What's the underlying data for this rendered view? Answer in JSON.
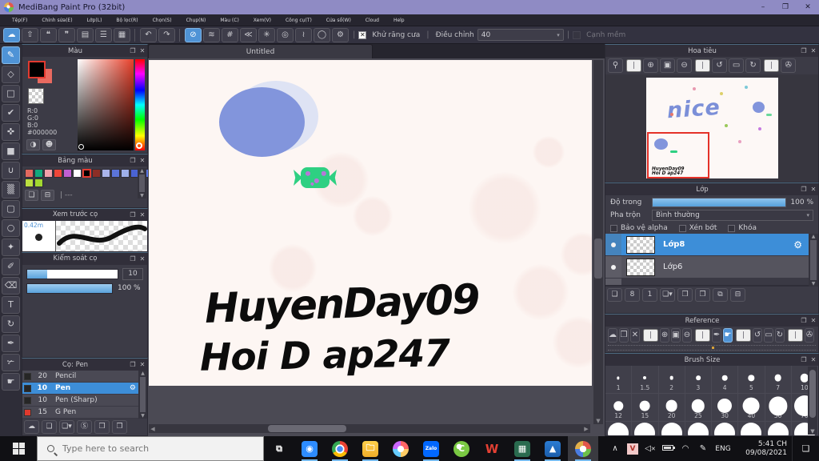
{
  "window": {
    "title": "MediBang Paint Pro (32bit)"
  },
  "icons": {
    "minimize": "–",
    "maximize": "❐",
    "close": "✕",
    "popout": "❐",
    "panel_close": "✕",
    "caret_down": "▾",
    "up_arrow": "▲",
    "down_arrow": "▼",
    "left_arrow": "◀",
    "right_arrow": "▶",
    "chevron_up": "∧",
    "gear": "⚙",
    "eye": "●"
  },
  "menu": {
    "items": [
      "Tệp(F)",
      "Chỉnh sửa(E)",
      "Lớp(L)",
      "Bộ lọc(R)",
      "Chọn(S)",
      "Chụp(N)",
      "Màu (C)",
      "Xem(V)",
      "Công cụ(T)",
      "Cửa sổ(W)",
      "Cloud",
      "Help"
    ]
  },
  "toolbar": {
    "buttons": [
      {
        "name": "cloud-save-button",
        "glyph": "☁",
        "active": true
      },
      {
        "name": "share-button",
        "glyph": "⇧"
      },
      {
        "name": "comment-filled-button",
        "glyph": "❝"
      },
      {
        "name": "comment-outline-button",
        "glyph": "❞"
      },
      {
        "name": "document-button",
        "glyph": "▤"
      },
      {
        "name": "list-button",
        "glyph": "☰"
      },
      {
        "name": "panel-layout-button",
        "glyph": "▦"
      },
      {
        "name": "toolbar-separator",
        "glyph": "",
        "sep": true
      },
      {
        "name": "undo-button",
        "glyph": "↶"
      },
      {
        "name": "redo-button",
        "glyph": "↷"
      },
      {
        "name": "toolbar-separator",
        "glyph": "",
        "sep": true
      },
      {
        "name": "snap-off-button",
        "glyph": "⊘",
        "active": true
      },
      {
        "name": "snap-parallel-button",
        "glyph": "≋"
      },
      {
        "name": "snap-grid-button",
        "glyph": "#"
      },
      {
        "name": "snap-vanishing-button",
        "glyph": "≪"
      },
      {
        "name": "snap-radial-button",
        "glyph": "✳"
      },
      {
        "name": "snap-concentric-button",
        "glyph": "◎"
      },
      {
        "name": "snap-curve-button",
        "glyph": "≀"
      },
      {
        "name": "snap-ellipse-button",
        "glyph": "◯"
      },
      {
        "name": "snap-settings-button",
        "glyph": "⚙"
      }
    ],
    "antialias_label": "Khử răng cưa",
    "antialias_checked": "✕",
    "correction_label": "Điều chỉnh",
    "correction_value": "40",
    "soft_edge_label": "Cạnh mềm"
  },
  "tools": [
    {
      "name": "brush-tool",
      "glyph": "✎",
      "active": true
    },
    {
      "name": "eraser-tool",
      "glyph": "◇"
    },
    {
      "name": "figure-tool",
      "glyph": "□"
    },
    {
      "name": "control-point-tool",
      "glyph": "✔"
    },
    {
      "name": "move-tool",
      "glyph": "✜"
    },
    {
      "name": "fill-rect-tool",
      "glyph": "■"
    },
    {
      "name": "bucket-tool",
      "glyph": "∪"
    },
    {
      "name": "gradient-tool",
      "glyph": "▒"
    },
    {
      "name": "select-marquee-tool",
      "glyph": "▢"
    },
    {
      "name": "lasso-tool",
      "glyph": "○"
    },
    {
      "name": "magic-wand-tool",
      "glyph": "✦"
    },
    {
      "name": "select-pen-tool",
      "glyph": "✐"
    },
    {
      "name": "select-eraser-tool",
      "glyph": "⌫"
    },
    {
      "name": "text-tool",
      "glyph": "T"
    },
    {
      "name": "rotate-view-tool",
      "glyph": "↻"
    },
    {
      "name": "eyedropper-tool",
      "glyph": "✒"
    },
    {
      "name": "divide-tool",
      "glyph": "✃"
    },
    {
      "name": "hand-tool",
      "glyph": "☛"
    }
  ],
  "color_panel": {
    "title": "Màu",
    "r": "R:0",
    "g": "G:0",
    "b": "B:0",
    "hex": "#000000",
    "buttons": [
      {
        "name": "palette-mode-button",
        "glyph": "◑"
      },
      {
        "name": "skin-color-button",
        "glyph": "☻"
      }
    ]
  },
  "palette_panel": {
    "title": "Bảng màu",
    "empty": "| ---",
    "swatches": [
      {
        "c": "#e2695f"
      },
      {
        "c": "#12a97e"
      },
      {
        "c": "#f2a0aa"
      },
      {
        "c": "#ef4639"
      },
      {
        "c": "#c05fd3"
      },
      {
        "c": "#ffffff"
      },
      {
        "c": "#000000",
        "selected": true
      },
      {
        "c": "#8c2e26"
      },
      {
        "c": "#a9b4ea"
      },
      {
        "c": "#5b74d8"
      },
      {
        "c": "#9fb0ea"
      },
      {
        "c": "#4a63d4"
      },
      {
        "c": "#5a78e8"
      },
      {
        "c": "#bbdf40"
      },
      {
        "c": "#a2d830"
      }
    ],
    "buttons": [
      {
        "name": "add-palette-color-button",
        "glyph": "❏"
      },
      {
        "name": "delete-palette-color-button",
        "glyph": "⊟"
      }
    ]
  },
  "preview_panel": {
    "title": "Xem trước cọ",
    "size": "0.42m"
  },
  "control_panel": {
    "title": "Kiểm soát cọ",
    "size_value": "10",
    "opacity_value": "100 %"
  },
  "brush_panel": {
    "title": "Cọ: Pen",
    "brushes": [
      {
        "size": "20",
        "name": "Pencil",
        "chip": "#262626"
      },
      {
        "size": "10",
        "name": "Pen",
        "chip": "#262626",
        "selected": true
      },
      {
        "size": "10",
        "name": "Pen (Sharp)",
        "chip": "#262626"
      },
      {
        "size": "15",
        "name": "G Pen",
        "chip": "#e03a2e"
      }
    ],
    "buttons": [
      {
        "name": "brush-cloud-button",
        "glyph": "☁"
      },
      {
        "name": "brush-add-button",
        "glyph": "❏"
      },
      {
        "name": "brush-add-menu-button",
        "glyph": "❏▾"
      },
      {
        "name": "brush-script-button",
        "glyph": "Ⓢ"
      },
      {
        "name": "brush-folder-button",
        "glyph": "❒"
      },
      {
        "name": "brush-duplicate-button",
        "glyph": "❐"
      }
    ]
  },
  "canvas": {
    "tab": "Untitled",
    "text_line1": "HuyenDay09",
    "text_line2": "Hoi D ap247"
  },
  "navigator": {
    "title": "Hoa tiêu",
    "thumb_word": "nice",
    "vp_line1": "HuyenDay09",
    "vp_line2": "Hoi D ap247",
    "buttons": [
      {
        "name": "nav-zoom-reset-button",
        "glyph": "⚲"
      },
      {
        "name": "nav-separator",
        "glyph": "",
        "sep": true
      },
      {
        "name": "nav-zoom-in-button",
        "glyph": "⊕"
      },
      {
        "name": "nav-fit-button",
        "glyph": "▣"
      },
      {
        "name": "nav-zoom-out-button",
        "glyph": "⊖"
      },
      {
        "name": "nav-separator",
        "glyph": "",
        "sep": true
      },
      {
        "name": "nav-rotate-left-button",
        "glyph": "↺"
      },
      {
        "name": "nav-rotate-reset-button",
        "glyph": "▭"
      },
      {
        "name": "nav-rotate-right-button",
        "glyph": "↻"
      },
      {
        "name": "nav-separator",
        "glyph": "",
        "sep": true
      },
      {
        "name": "nav-lock-button",
        "glyph": "✇"
      }
    ]
  },
  "layers_panel": {
    "title": "Lớp",
    "opacity_label": "Độ trong",
    "opacity_value": "100 %",
    "blend_label": "Pha trộn",
    "blend_value": "Bình thường",
    "cb_alpha": "Bảo vệ alpha",
    "cb_clip": "Xén bớt",
    "cb_lock": "Khóa",
    "layers": [
      {
        "name": "Lớp8",
        "selected": true
      },
      {
        "name": "Lớp6"
      }
    ],
    "buttons": [
      {
        "name": "layer-add-button",
        "glyph": "❏"
      },
      {
        "name": "layer-add-8bit-button",
        "glyph": "8"
      },
      {
        "name": "layer-add-1bit-button",
        "glyph": "1"
      },
      {
        "name": "layer-add-menu-button",
        "glyph": "❏▾"
      },
      {
        "name": "layer-folder-button",
        "glyph": "❒"
      },
      {
        "name": "layer-duplicate-button",
        "glyph": "❐"
      },
      {
        "name": "layer-merge-button",
        "glyph": "⧉"
      },
      {
        "name": "layer-delete-button",
        "glyph": "⊟"
      }
    ]
  },
  "reference_panel": {
    "title": "Reference",
    "buttons": [
      {
        "name": "ref-cloud-button",
        "glyph": "☁"
      },
      {
        "name": "ref-open-button",
        "glyph": "❒"
      },
      {
        "name": "ref-clear-button",
        "glyph": "✕"
      },
      {
        "name": "ref-separator",
        "glyph": "",
        "sep": true
      },
      {
        "name": "ref-zoom-in-button",
        "glyph": "⊕"
      },
      {
        "name": "ref-fit-button",
        "glyph": "▣"
      },
      {
        "name": "ref-zoom-out-button",
        "glyph": "⊖"
      },
      {
        "name": "ref-separator",
        "glyph": "",
        "sep": true
      },
      {
        "name": "ref-eyedropper-button",
        "glyph": "✒"
      },
      {
        "name": "ref-hand-button",
        "glyph": "☛",
        "active": true
      },
      {
        "name": "ref-separator",
        "glyph": "",
        "sep": true
      },
      {
        "name": "ref-rotate-left-button",
        "glyph": "↺"
      },
      {
        "name": "ref-rotate-reset-button",
        "glyph": "▭"
      },
      {
        "name": "ref-rotate-right-button",
        "glyph": "↻"
      },
      {
        "name": "ref-separator",
        "glyph": "",
        "sep": true
      },
      {
        "name": "ref-lock-button",
        "glyph": "✇"
      }
    ]
  },
  "brush_size_panel": {
    "title": "Brush Size",
    "rows": [
      [
        {
          "v": "1"
        },
        {
          "v": "1.5"
        },
        {
          "v": "2"
        },
        {
          "v": "3"
        },
        {
          "v": "4"
        },
        {
          "v": "5"
        },
        {
          "v": "7"
        },
        {
          "v": "10"
        }
      ],
      [
        {
          "v": "12"
        },
        {
          "v": "15"
        },
        {
          "v": "20"
        },
        {
          "v": "25"
        },
        {
          "v": "30"
        },
        {
          "v": "40"
        },
        {
          "v": "50"
        },
        {
          "v": "70"
        }
      ]
    ]
  },
  "taskbar": {
    "search_placeholder": "Type here to search",
    "apps": [
      {
        "name": "task-view-button",
        "glyph": "⧉",
        "bg": "transparent",
        "circ": false
      },
      {
        "name": "zoom-app-icon",
        "glyph": "◉",
        "bg": "#2d8cff",
        "running": true
      },
      {
        "name": "chrome-icon",
        "glyph": "",
        "bg": "radial-gradient(circle at 50% 50%, #4a8cf7 0 27%, #fff 27% 40%, rgba(0,0,0,0) 40%), conic-gradient(#ea4335 0deg 120deg, #fbbc05 120deg 240deg, #34a853 240deg 360deg)",
        "circ": true,
        "running": true
      },
      {
        "name": "file-explorer-icon",
        "glyph": "🗀",
        "bg": "linear-gradient(#ffd04a,#f0ad2a)",
        "running": true
      },
      {
        "name": "paint-app-icon",
        "glyph": "",
        "bg": "radial-gradient(circle, #fff 0 28%, rgba(0,0,0,0) 28%), conic-gradient(#f66 0 25%, #fc6 25% 50%, #6cf 50% 75%, #c6f 75% 100%)",
        "circ": true
      },
      {
        "name": "zalo-icon",
        "glyph": "Zalo",
        "bg": "#0168ff",
        "small": true,
        "running": true
      },
      {
        "name": "coccoc-icon",
        "glyph": "C",
        "bg": "radial-gradient(circle at 35% 35%, #fff 0 18%, #7ac943 18% 100%)",
        "circ": true
      },
      {
        "name": "wps-office-icon",
        "glyph": "W",
        "bg": "transparent",
        "red": true
      },
      {
        "name": "spreadsheet-icon",
        "glyph": "▦",
        "bg": "#2a6b4f",
        "running": true
      },
      {
        "name": "photos-icon",
        "glyph": "▲",
        "bg": "linear-gradient(#2b7cd3,#1a5dab)",
        "running": true
      },
      {
        "name": "medibang-icon",
        "glyph": "",
        "bg": "radial-gradient(circle, #fff 0 30%, rgba(0,0,0,0) 30%), conic-gradient(#e2574c 0 25%, #6cbf4a 25% 50%, #4a7de2 50% 75%, #e2b04a 75% 100%)",
        "circ": true,
        "running": true,
        "activeapp": true
      }
    ],
    "tray": {
      "lang": "ENG",
      "time": "5:41 CH",
      "date": "09/08/2021"
    }
  },
  "colors": {
    "accent": "#3d8ed8",
    "canvas_bg": "#fdf6f3",
    "ellipse": "#8295dc",
    "ellipse_shadow": "#dee3f4",
    "candy": "#2ed082",
    "candy_dot": "#b678d8",
    "viewport_red": "#e43229",
    "nice_blue": "#7b8fd8"
  }
}
